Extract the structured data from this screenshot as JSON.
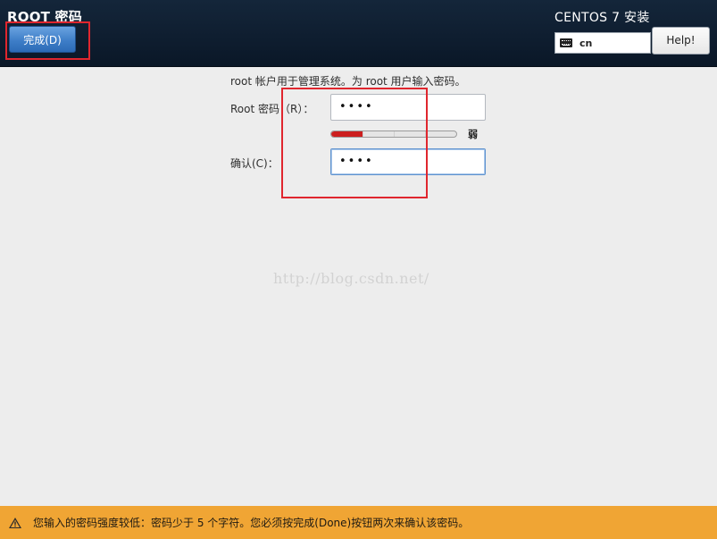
{
  "header": {
    "page_title": "ROOT 密码",
    "done_label": "完成(D)",
    "product_title": "CENTOS 7 安装",
    "keyboard_layout": "cn",
    "help_label": "Help!"
  },
  "form": {
    "intro": "root 帐户用于管理系统。为 root 用户输入密码。",
    "password_label": "Root 密码（R）：",
    "password_value": "••••",
    "strength_fraction": 0.25,
    "strength_label": "弱",
    "confirm_label": "确认(C)：",
    "confirm_value": "••••"
  },
  "watermark": "http://blog.csdn.net/",
  "warning": {
    "icon": "warning-icon",
    "text": "您输入的密码强度较低：密码少于 5 个字符。您必须按完成(Done)按钮两次来确认该密码。"
  },
  "colors": {
    "header_bg": "#0f1e30",
    "accent_blue": "#3e7ec8",
    "highlight_red": "#e0262e",
    "strength_red": "#cc1f1f",
    "warning_bg": "#f0a534"
  }
}
